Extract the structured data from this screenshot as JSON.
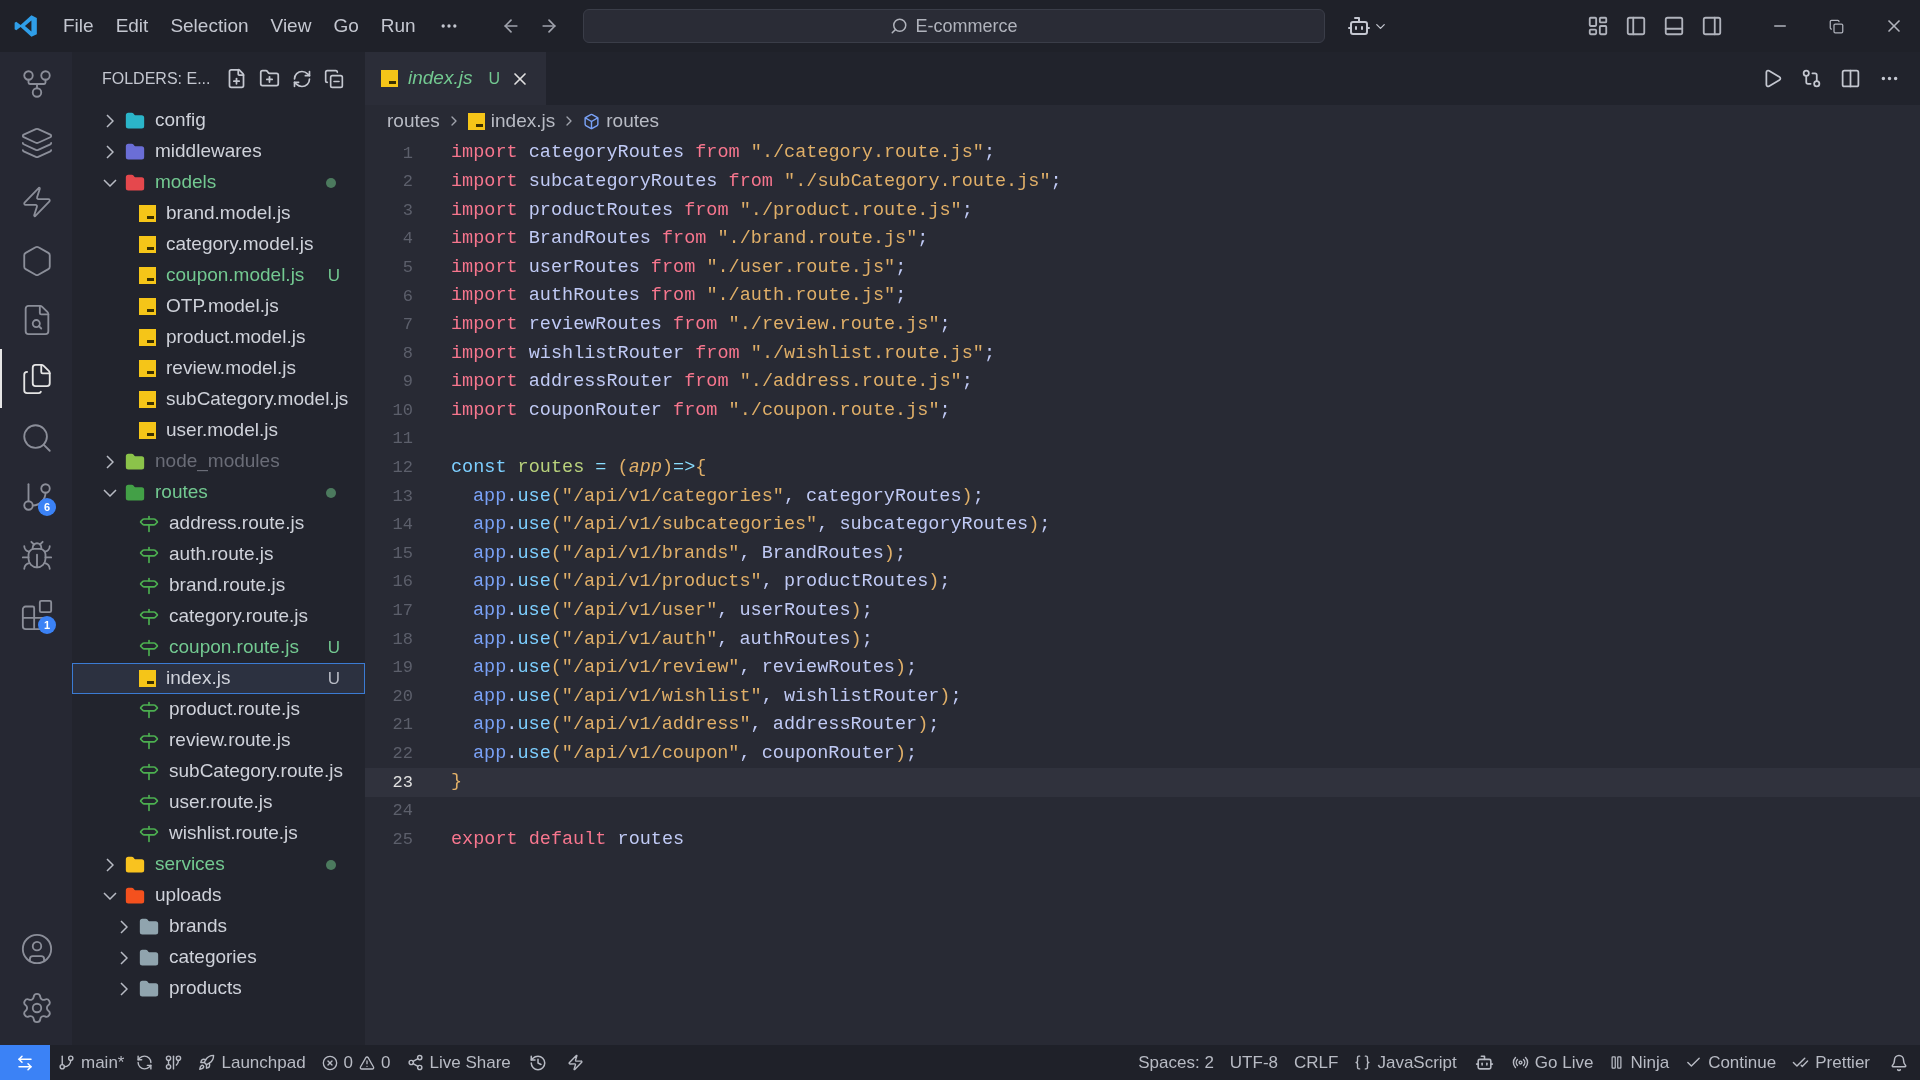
{
  "menu": [
    "File",
    "Edit",
    "Selection",
    "View",
    "Go",
    "Run"
  ],
  "command_center": {
    "placeholder": "E-commerce"
  },
  "activity_bar": [
    {
      "kind": "graph",
      "selected": false
    },
    {
      "kind": "layers",
      "selected": false
    },
    {
      "kind": "bolt",
      "selected": false
    },
    {
      "kind": "hexagon",
      "selected": false
    },
    {
      "kind": "history",
      "selected": false
    },
    {
      "kind": "explorer",
      "selected": true
    },
    {
      "kind": "search",
      "selected": false
    },
    {
      "kind": "scm",
      "selected": false,
      "badge": "6"
    },
    {
      "kind": "debug",
      "selected": false
    },
    {
      "kind": "extensions",
      "selected": false,
      "badge": "1"
    }
  ],
  "activity_bar_bottom": [
    {
      "kind": "account",
      "selected": false
    },
    {
      "kind": "settings",
      "selected": false
    }
  ],
  "explorer": {
    "title": "FOLDERS: E...",
    "tree": [
      {
        "name": "config",
        "kind": "folder",
        "color": "#2bb5c9",
        "expanded": false,
        "untracked": false,
        "ignored": false,
        "dot": false,
        "selected": false
      },
      {
        "name": "middlewares",
        "kind": "folder",
        "color": "#6b6ed6",
        "expanded": false,
        "untracked": false,
        "ignored": false,
        "dot": false,
        "selected": false
      },
      {
        "name": "models",
        "kind": "folder",
        "color": "#e5484d",
        "expanded": true,
        "untracked": true,
        "ignored": false,
        "dot": true,
        "selected": false,
        "children": [
          {
            "name": "brand.model.js",
            "kind": "js",
            "untracked": false,
            "ignored": false,
            "selected": false
          },
          {
            "name": "category.model.js",
            "kind": "js",
            "untracked": false,
            "ignored": false,
            "selected": false
          },
          {
            "name": "coupon.model.js",
            "kind": "js",
            "untracked": true,
            "ignored": false,
            "badge": "U",
            "selected": false
          },
          {
            "name": "OTP.model.js",
            "kind": "js",
            "untracked": false,
            "ignored": false,
            "selected": false
          },
          {
            "name": "product.model.js",
            "kind": "js",
            "untracked": false,
            "ignored": false,
            "selected": false
          },
          {
            "name": "review.model.js",
            "kind": "js",
            "untracked": false,
            "ignored": false,
            "selected": false
          },
          {
            "name": "subCategory.model.js",
            "kind": "js",
            "untracked": false,
            "ignored": false,
            "selected": false
          },
          {
            "name": "user.model.js",
            "kind": "js",
            "untracked": false,
            "ignored": false,
            "selected": false
          }
        ]
      },
      {
        "name": "node_modules",
        "kind": "folder",
        "color": "#8bc34a",
        "expanded": false,
        "untracked": false,
        "ignored": true,
        "dot": false,
        "selected": false
      },
      {
        "name": "routes",
        "kind": "folder",
        "color": "#43a047",
        "expanded": true,
        "untracked": true,
        "ignored": false,
        "dot": true,
        "selected": false,
        "children": [
          {
            "name": "address.route.js",
            "kind": "route",
            "untracked": false,
            "ignored": false,
            "selected": false
          },
          {
            "name": "auth.route.js",
            "kind": "route",
            "untracked": false,
            "ignored": false,
            "selected": false
          },
          {
            "name": "brand.route.js",
            "kind": "route",
            "untracked": false,
            "ignored": false,
            "selected": false
          },
          {
            "name": "category.route.js",
            "kind": "route",
            "untracked": false,
            "ignored": false,
            "selected": false
          },
          {
            "name": "coupon.route.js",
            "kind": "route",
            "untracked": true,
            "ignored": false,
            "badge": "U",
            "selected": false
          },
          {
            "name": "index.js",
            "kind": "js",
            "untracked": false,
            "ignored": false,
            "badge": "U",
            "selected": true
          },
          {
            "name": "product.route.js",
            "kind": "route",
            "untracked": false,
            "ignored": false,
            "selected": false
          },
          {
            "name": "review.route.js",
            "kind": "route",
            "untracked": false,
            "ignored": false,
            "selected": false
          },
          {
            "name": "subCategory.route.js",
            "kind": "route",
            "untracked": false,
            "ignored": false,
            "selected": false
          },
          {
            "name": "user.route.js",
            "kind": "route",
            "untracked": false,
            "ignored": false,
            "selected": false
          },
          {
            "name": "wishlist.route.js",
            "kind": "route",
            "untracked": false,
            "ignored": false,
            "selected": false
          }
        ]
      },
      {
        "name": "services",
        "kind": "folder",
        "color": "#f9c31f",
        "expanded": false,
        "untracked": true,
        "ignored": false,
        "dot": true,
        "selected": false
      },
      {
        "name": "uploads",
        "kind": "folder",
        "color": "#f4511e",
        "expanded": true,
        "untracked": false,
        "ignored": false,
        "dot": false,
        "selected": false,
        "children": [
          {
            "name": "brands",
            "kind": "folder",
            "color": "#90a4ae",
            "expanded": false,
            "untracked": false,
            "ignored": false,
            "dot": false,
            "selected": false
          },
          {
            "name": "categories",
            "kind": "folder",
            "color": "#90a4ae",
            "expanded": false,
            "untracked": false,
            "ignored": false,
            "dot": false,
            "selected": false
          },
          {
            "name": "products",
            "kind": "folder",
            "color": "#90a4ae",
            "expanded": false,
            "untracked": false,
            "ignored": false,
            "dot": false,
            "selected": false
          }
        ]
      }
    ]
  },
  "tabs": [
    {
      "label": "index.js",
      "badge": "U",
      "selected": true
    }
  ],
  "breadcrumb": [
    "routes",
    "index.js",
    "routes"
  ],
  "editor": {
    "lines": [
      {
        "n": "1",
        "tokens": [
          {
            "kind": "kw",
            "text": "import"
          },
          {
            "kind": "id",
            "text": " categoryRoutes "
          },
          {
            "kind": "kw",
            "text": "from"
          },
          {
            "kind": "str",
            "text": " \"./category.route.js\""
          },
          {
            "kind": "p",
            "text": ";"
          }
        ]
      },
      {
        "n": "2",
        "tokens": [
          {
            "kind": "kw",
            "text": "import"
          },
          {
            "kind": "id",
            "text": " subcategoryRoutes "
          },
          {
            "kind": "kw",
            "text": "from"
          },
          {
            "kind": "str",
            "text": " \"./subCategory.route.js\""
          },
          {
            "kind": "p",
            "text": ";"
          }
        ]
      },
      {
        "n": "3",
        "tokens": [
          {
            "kind": "kw",
            "text": "import"
          },
          {
            "kind": "id",
            "text": " productRoutes "
          },
          {
            "kind": "kw",
            "text": "from"
          },
          {
            "kind": "str",
            "text": " \"./product.route.js\""
          },
          {
            "kind": "p",
            "text": ";"
          }
        ]
      },
      {
        "n": "4",
        "tokens": [
          {
            "kind": "kw",
            "text": "import"
          },
          {
            "kind": "id",
            "text": " BrandRoutes "
          },
          {
            "kind": "kw",
            "text": "from"
          },
          {
            "kind": "str",
            "text": " \"./brand.route.js\""
          },
          {
            "kind": "p",
            "text": ";"
          }
        ]
      },
      {
        "n": "5",
        "tokens": [
          {
            "kind": "kw",
            "text": "import"
          },
          {
            "kind": "id",
            "text": " userRoutes "
          },
          {
            "kind": "kw",
            "text": "from"
          },
          {
            "kind": "str",
            "text": " \"./user.route.js\""
          },
          {
            "kind": "p",
            "text": ";"
          }
        ]
      },
      {
        "n": "6",
        "tokens": [
          {
            "kind": "kw",
            "text": "import"
          },
          {
            "kind": "id",
            "text": " authRoutes "
          },
          {
            "kind": "kw",
            "text": "from"
          },
          {
            "kind": "str",
            "text": " \"./auth.route.js\""
          },
          {
            "kind": "p",
            "text": ";"
          }
        ]
      },
      {
        "n": "7",
        "tokens": [
          {
            "kind": "kw",
            "text": "import"
          },
          {
            "kind": "id",
            "text": " reviewRoutes "
          },
          {
            "kind": "kw",
            "text": "from"
          },
          {
            "kind": "str",
            "text": " \"./review.route.js\""
          },
          {
            "kind": "p",
            "text": ";"
          }
        ]
      },
      {
        "n": "8",
        "tokens": [
          {
            "kind": "kw",
            "text": "import"
          },
          {
            "kind": "id",
            "text": " wishlistRouter "
          },
          {
            "kind": "kw",
            "text": "from"
          },
          {
            "kind": "str",
            "text": " \"./wishlist.route.js\""
          },
          {
            "kind": "p",
            "text": ";"
          }
        ]
      },
      {
        "n": "9",
        "tokens": [
          {
            "kind": "kw",
            "text": "import"
          },
          {
            "kind": "id",
            "text": " addressRouter "
          },
          {
            "kind": "kw",
            "text": "from"
          },
          {
            "kind": "str",
            "text": " \"./address.route.js\""
          },
          {
            "kind": "p",
            "text": ";"
          }
        ]
      },
      {
        "n": "10",
        "tokens": [
          {
            "kind": "kw",
            "text": "import"
          },
          {
            "kind": "id",
            "text": " couponRouter "
          },
          {
            "kind": "kw",
            "text": "from"
          },
          {
            "kind": "str",
            "text": " \"./coupon.route.js\""
          },
          {
            "kind": "p",
            "text": ";"
          }
        ]
      },
      {
        "n": "11"
      },
      {
        "n": "12",
        "tokens": [
          {
            "kind": "decl",
            "text": "const"
          },
          {
            "kind": "var",
            "text": " routes "
          },
          {
            "kind": "op",
            "text": "= "
          },
          {
            "kind": "br",
            "text": "("
          },
          {
            "kind": "param",
            "text": "app"
          },
          {
            "kind": "br",
            "text": ")"
          },
          {
            "kind": "op",
            "text": "=>"
          },
          {
            "kind": "br",
            "text": "{"
          }
        ]
      },
      {
        "n": "13",
        "indent": true,
        "tokens": [
          {
            "kind": "obj",
            "text": "app"
          },
          {
            "kind": "p",
            "text": "."
          },
          {
            "kind": "fn",
            "text": "use"
          },
          {
            "kind": "br",
            "text": "("
          },
          {
            "kind": "str",
            "text": "\"/api/v1/categories\""
          },
          {
            "kind": "p",
            "text": ", "
          },
          {
            "kind": "id",
            "text": "categoryRoutes"
          },
          {
            "kind": "br",
            "text": ")"
          },
          {
            "kind": "p",
            "text": ";"
          }
        ]
      },
      {
        "n": "14",
        "indent": true,
        "tokens": [
          {
            "kind": "obj",
            "text": "app"
          },
          {
            "kind": "p",
            "text": "."
          },
          {
            "kind": "fn",
            "text": "use"
          },
          {
            "kind": "br",
            "text": "("
          },
          {
            "kind": "str",
            "text": "\"/api/v1/subcategories\""
          },
          {
            "kind": "p",
            "text": ", "
          },
          {
            "kind": "id",
            "text": "subcategoryRoutes"
          },
          {
            "kind": "br",
            "text": ")"
          },
          {
            "kind": "p",
            "text": ";"
          }
        ]
      },
      {
        "n": "15",
        "indent": true,
        "tokens": [
          {
            "kind": "obj",
            "text": "app"
          },
          {
            "kind": "p",
            "text": "."
          },
          {
            "kind": "fn",
            "text": "use"
          },
          {
            "kind": "br",
            "text": "("
          },
          {
            "kind": "str",
            "text": "\"/api/v1/brands\""
          },
          {
            "kind": "p",
            "text": ", "
          },
          {
            "kind": "id",
            "text": "BrandRoutes"
          },
          {
            "kind": "br",
            "text": ")"
          },
          {
            "kind": "p",
            "text": ";"
          }
        ]
      },
      {
        "n": "16",
        "indent": true,
        "tokens": [
          {
            "kind": "obj",
            "text": "app"
          },
          {
            "kind": "p",
            "text": "."
          },
          {
            "kind": "fn",
            "text": "use"
          },
          {
            "kind": "br",
            "text": "("
          },
          {
            "kind": "str",
            "text": "\"/api/v1/products\""
          },
          {
            "kind": "p",
            "text": ", "
          },
          {
            "kind": "id",
            "text": "productRoutes"
          },
          {
            "kind": "br",
            "text": ")"
          },
          {
            "kind": "p",
            "text": ";"
          }
        ]
      },
      {
        "n": "17",
        "indent": true,
        "tokens": [
          {
            "kind": "obj",
            "text": "app"
          },
          {
            "kind": "p",
            "text": "."
          },
          {
            "kind": "fn",
            "text": "use"
          },
          {
            "kind": "br",
            "text": "("
          },
          {
            "kind": "str",
            "text": "\"/api/v1/user\""
          },
          {
            "kind": "p",
            "text": ", "
          },
          {
            "kind": "id",
            "text": "userRoutes"
          },
          {
            "kind": "br",
            "text": ")"
          },
          {
            "kind": "p",
            "text": ";"
          }
        ]
      },
      {
        "n": "18",
        "indent": true,
        "tokens": [
          {
            "kind": "obj",
            "text": "app"
          },
          {
            "kind": "p",
            "text": "."
          },
          {
            "kind": "fn",
            "text": "use"
          },
          {
            "kind": "br",
            "text": "("
          },
          {
            "kind": "str",
            "text": "\"/api/v1/auth\""
          },
          {
            "kind": "p",
            "text": ", "
          },
          {
            "kind": "id",
            "text": "authRoutes"
          },
          {
            "kind": "br",
            "text": ")"
          },
          {
            "kind": "p",
            "text": ";"
          }
        ]
      },
      {
        "n": "19",
        "indent": true,
        "tokens": [
          {
            "kind": "obj",
            "text": "app"
          },
          {
            "kind": "p",
            "text": "."
          },
          {
            "kind": "fn",
            "text": "use"
          },
          {
            "kind": "br",
            "text": "("
          },
          {
            "kind": "str",
            "text": "\"/api/v1/review\""
          },
          {
            "kind": "p",
            "text": ", "
          },
          {
            "kind": "id",
            "text": "reviewRoutes"
          },
          {
            "kind": "br",
            "text": ")"
          },
          {
            "kind": "p",
            "text": ";"
          }
        ]
      },
      {
        "n": "20",
        "indent": true,
        "tokens": [
          {
            "kind": "obj",
            "text": "app"
          },
          {
            "kind": "p",
            "text": "."
          },
          {
            "kind": "fn",
            "text": "use"
          },
          {
            "kind": "br",
            "text": "("
          },
          {
            "kind": "str",
            "text": "\"/api/v1/wishlist\""
          },
          {
            "kind": "p",
            "text": ", "
          },
          {
            "kind": "id",
            "text": "wishlistRouter"
          },
          {
            "kind": "br",
            "text": ")"
          },
          {
            "kind": "p",
            "text": ";"
          }
        ]
      },
      {
        "n": "21",
        "indent": true,
        "tokens": [
          {
            "kind": "obj",
            "text": "app"
          },
          {
            "kind": "p",
            "text": "."
          },
          {
            "kind": "fn",
            "text": "use"
          },
          {
            "kind": "br",
            "text": "("
          },
          {
            "kind": "str",
            "text": "\"/api/v1/address\""
          },
          {
            "kind": "p",
            "text": ", "
          },
          {
            "kind": "id",
            "text": "addressRouter"
          },
          {
            "kind": "br",
            "text": ")"
          },
          {
            "kind": "p",
            "text": ";"
          }
        ]
      },
      {
        "n": "22",
        "indent": true,
        "tokens": [
          {
            "kind": "obj",
            "text": "app"
          },
          {
            "kind": "p",
            "text": "."
          },
          {
            "kind": "fn",
            "text": "use"
          },
          {
            "kind": "br",
            "text": "("
          },
          {
            "kind": "str",
            "text": "\"/api/v1/coupon\""
          },
          {
            "kind": "p",
            "text": ", "
          },
          {
            "kind": "id",
            "text": "couponRouter"
          },
          {
            "kind": "br",
            "text": ")"
          },
          {
            "kind": "p",
            "text": ";"
          }
        ]
      },
      {
        "n": "23",
        "current": true,
        "tokens": [
          {
            "kind": "br",
            "text": "}"
          }
        ]
      },
      {
        "n": "24"
      },
      {
        "n": "25",
        "tokens": [
          {
            "kind": "kw",
            "text": "export default"
          },
          {
            "kind": "id",
            "text": " routes"
          }
        ]
      }
    ]
  },
  "status_bar": {
    "left": [
      {
        "kind": "branch",
        "text": "main*"
      },
      {
        "kind": "launchpad",
        "text": "Launchpad"
      },
      {
        "kind": "problems",
        "errors": "0",
        "warnings": "0"
      },
      {
        "kind": "liveshare",
        "text": "Live Share"
      }
    ],
    "right": [
      {
        "kind": "plain",
        "text": "Spaces: 2"
      },
      {
        "kind": "plain",
        "text": "UTF-8"
      },
      {
        "kind": "plain",
        "text": "CRLF"
      },
      {
        "kind": "language",
        "text": "JavaScript"
      },
      {
        "kind": "copilot"
      },
      {
        "kind": "golive",
        "text": "Go Live"
      },
      {
        "kind": "ninja",
        "text": "Ninja"
      },
      {
        "kind": "check",
        "text": "Continue"
      },
      {
        "kind": "doublecheck",
        "text": "Prettier"
      },
      {
        "kind": "bell"
      }
    ]
  }
}
